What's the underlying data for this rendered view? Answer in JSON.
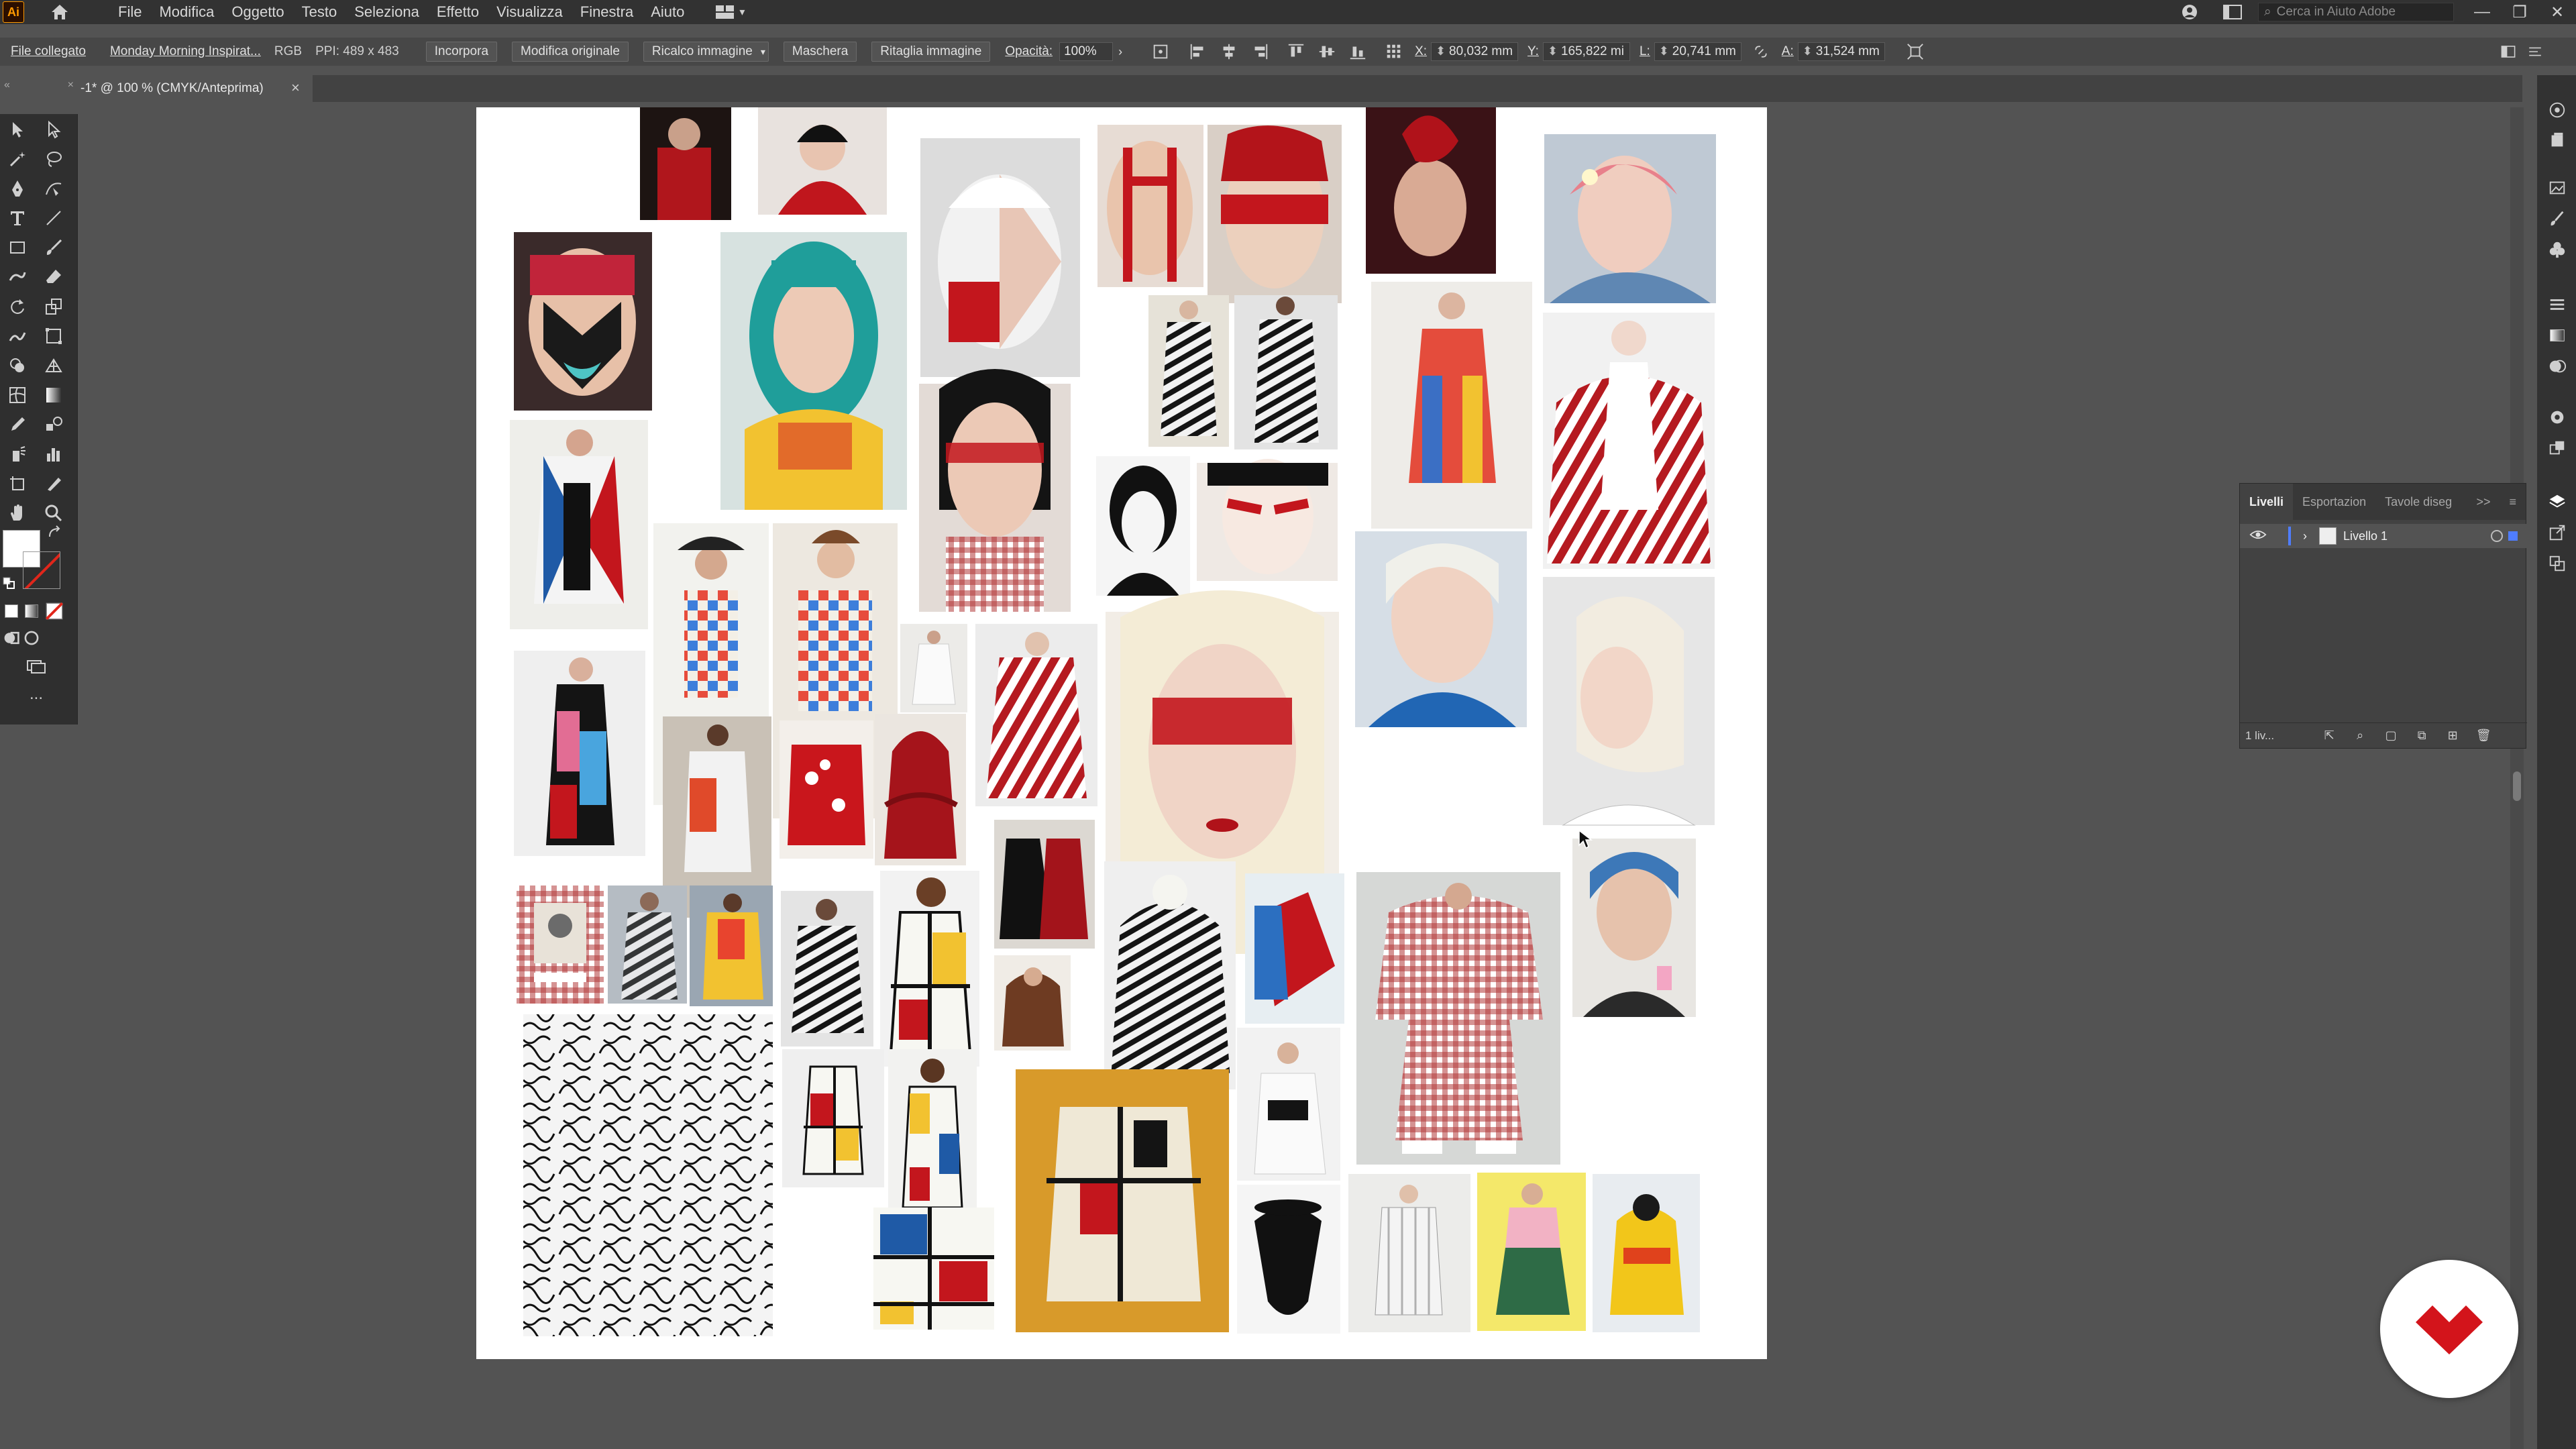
{
  "app": {
    "logo_text": "Ai",
    "menu": [
      "File",
      "Modifica",
      "Oggetto",
      "Testo",
      "Seleziona",
      "Effetto",
      "Visualizza",
      "Finestra",
      "Aiuto"
    ],
    "help_search_placeholder": "Cerca in Aiuto Adobe",
    "accent_color": "#ff9a00"
  },
  "control_bar": {
    "linked_file": "File collegato",
    "file_name": "Monday Morning Inspirat...",
    "color_mode": "RGB",
    "ppi": "PPI: 489 x 483",
    "embed": "Incorpora",
    "edit_original": "Modifica originale",
    "crop_image": "Ricalco immagine",
    "mask": "Maschera",
    "trim_image": "Ritaglia immagine",
    "opacity_label": "Opacità:",
    "opacity_value": "100%",
    "x_label": "X:",
    "x_value": "80,032 mm",
    "y_label": "Y:",
    "y_value": "165,822 mi",
    "w_label": "L:",
    "w_value": "20,741 mm",
    "h_label": "A:",
    "h_value": "31,524 mm"
  },
  "document_tab": {
    "title": "-1* @ 100 % (CMYK/Anteprima)",
    "close": "×"
  },
  "layers_panel": {
    "tabs": [
      "Livelli",
      "Esportazion",
      "Tavole diseg"
    ],
    "more": ">>",
    "layer_name": "Livello 1",
    "footer_count": "1 liv...",
    "layer_color": "#4f7dff"
  },
  "toolbar": {
    "tools": [
      "selection-tool",
      "direct-selection-tool",
      "magic-wand-tool",
      "lasso-tool",
      "pen-tool",
      "curvature-tool",
      "type-tool",
      "line-tool",
      "rectangle-tool",
      "paintbrush-tool",
      "shaper-tool",
      "eraser-tool",
      "rotate-tool",
      "scale-tool",
      "warp-tool",
      "free-transform-tool",
      "shape-builder-tool",
      "perspective-grid-tool",
      "mesh-tool",
      "gradient-tool",
      "eyedropper-tool",
      "blend-tool",
      "symbol-sprayer-tool",
      "column-graph-tool",
      "artboard-tool",
      "slice-tool",
      "hand-tool",
      "zoom-tool"
    ],
    "more_tools": "..."
  },
  "moodboard": {
    "description_colors": {
      "red": "#c8161d",
      "blue": "#1f5aa6",
      "yellow": "#e8b923",
      "black": "#141414",
      "white": "#f4f4f4",
      "teal": "#1f9e9a"
    }
  }
}
